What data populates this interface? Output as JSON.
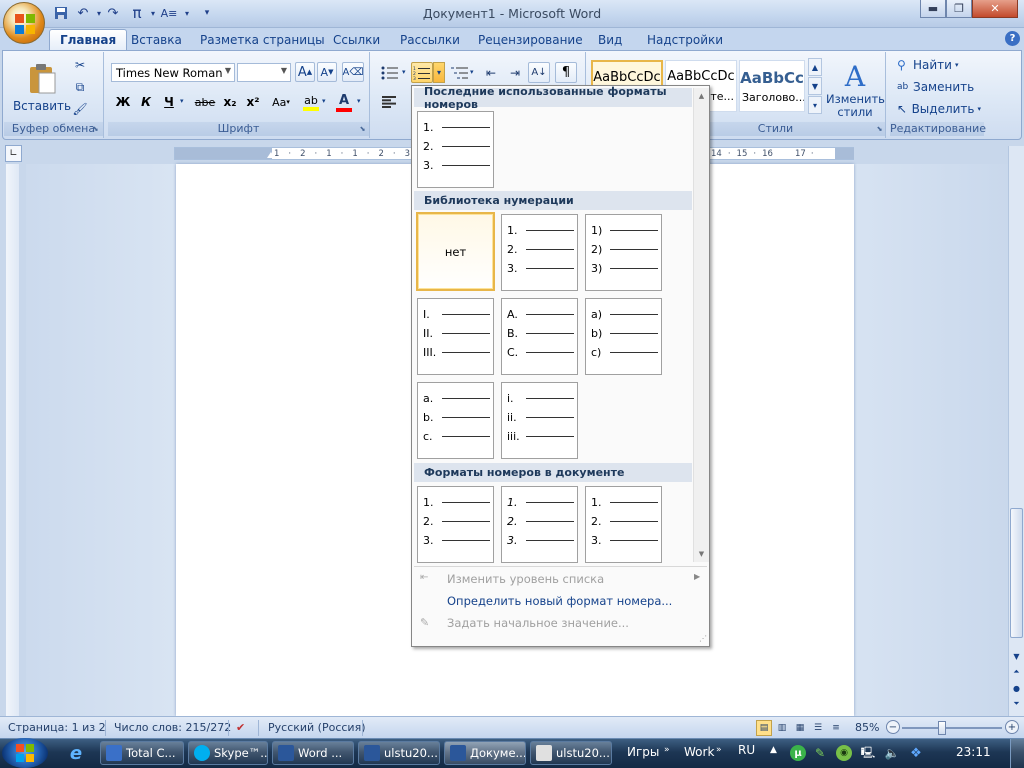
{
  "window": {
    "title": "Документ1 - Microsoft Word"
  },
  "tabs": [
    "Главная",
    "Вставка",
    "Разметка страницы",
    "Ссылки",
    "Рассылки",
    "Рецензирование",
    "Вид",
    "Надстройки"
  ],
  "clipboard": {
    "paste_label": "Вставить",
    "group_label": "Буфер обмена"
  },
  "font": {
    "name": "Times New Roman",
    "size": "",
    "group_label": "Шрифт",
    "bold": "Ж",
    "italic": "К",
    "underline": "Ч",
    "strike": "abe",
    "sub": "x₂",
    "sup": "x²",
    "case": "Aa",
    "grow": "A",
    "shrink": "A"
  },
  "styles": {
    "tiles": [
      "AaBbCcDc",
      "AaBbCcDc",
      "AaBbCc"
    ],
    "tile3_caption": "Заголово...",
    "tile2_caption": "те...",
    "change_label": "Изменить стили",
    "group_label": "Стили"
  },
  "editing": {
    "find": "Найти",
    "replace": "Заменить",
    "select": "Выделить",
    "group_label": "Редактирование"
  },
  "ruler": {
    "ticks": [
      "3",
      "·",
      "1",
      "·",
      "2",
      "·",
      "1",
      "·",
      "1",
      "·",
      "2",
      "·",
      "3",
      "·",
      "4",
      "14",
      "·",
      "15",
      "·",
      "16",
      "·",
      "17",
      "·"
    ]
  },
  "dropdown": {
    "recent_header": "Последние использованные форматы номеров",
    "recent": [
      [
        "1.",
        "2.",
        "3."
      ]
    ],
    "library_header": "Библиотека нумерации",
    "none_label": "нет",
    "library": [
      [
        "1.",
        "2.",
        "3."
      ],
      [
        "1)",
        "2)",
        "3)"
      ],
      [
        "I.",
        "II.",
        "III."
      ],
      [
        "A.",
        "B.",
        "C."
      ],
      [
        "a)",
        "b)",
        "c)"
      ],
      [
        "a.",
        "b.",
        "c."
      ],
      [
        "i.",
        "ii.",
        "iii."
      ]
    ],
    "doc_header": "Форматы номеров в документе",
    "doc_formats": [
      [
        "1.",
        "2.",
        "3."
      ],
      [
        "1.",
        "2.",
        "3."
      ],
      [
        "1.",
        "2.",
        "3."
      ]
    ],
    "menu": [
      {
        "label": "Изменить уровень списка",
        "disabled": true
      },
      {
        "label": "Определить новый формат номера...",
        "disabled": false
      },
      {
        "label": "Задать начальное значение...",
        "disabled": true
      }
    ]
  },
  "status": {
    "page": "Страница: 1 из 2",
    "words": "Число слов: 215/272",
    "lang": "Русский (Россия)",
    "zoom": "85%"
  },
  "taskbar": {
    "items": [
      "Total C...",
      "Skype™...",
      "Word ...",
      "ulstu20...",
      "Докуме...",
      "ulstu20..."
    ],
    "tray_words": [
      "Игры",
      "Work",
      "RU"
    ],
    "clock": "23:11"
  },
  "colors": {
    "accent": "#15428b",
    "highlight": "#ffff00",
    "fontcolor": "#ff0000",
    "selection": "#e8b649"
  }
}
